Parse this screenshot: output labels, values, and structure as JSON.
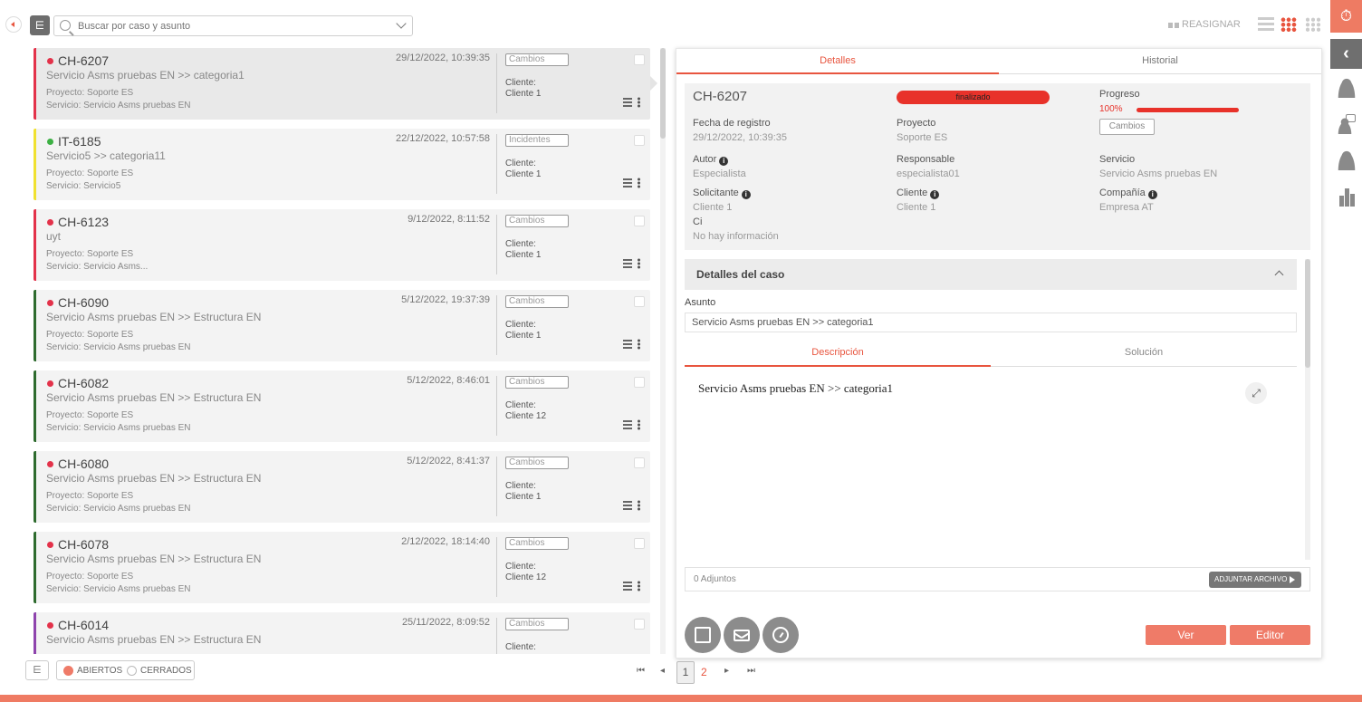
{
  "toolbar": {
    "search_placeholder": "Buscar por caso y asunto",
    "reassign_label": "REASIGNAR",
    "accent_color": "#e8553f"
  },
  "cases": [
    {
      "id": "CH-6207",
      "date": "29/12/2022, 10:39:35",
      "subject": "Servicio Asms pruebas EN >> categoria1",
      "project": "Proyecto: Soporte ES",
      "service": "Servicio: Servicio Asms pruebas EN",
      "category": "Cambios",
      "client_label": "Cliente:",
      "client": "Cliente 1",
      "dot_color": "#e3324a",
      "bar_color": "#e3324a"
    },
    {
      "id": "IT-6185",
      "date": "22/12/2022, 10:57:58",
      "subject": "Servicio5 >> categoria11",
      "project": "Proyecto: Soporte ES",
      "service": "Servicio: Servicio5",
      "category": "Incidentes",
      "client_label": "Cliente:",
      "client": "Cliente 1",
      "dot_color": "#3cb043",
      "bar_color": "#f0e130"
    },
    {
      "id": "CH-6123",
      "date": "9/12/2022, 8:11:52",
      "subject": "uyt",
      "project": "Proyecto: Soporte ES",
      "service": "Servicio: Servicio Asms...",
      "category": "Cambios",
      "client_label": "Cliente:",
      "client": "Cliente 1",
      "dot_color": "#e3324a",
      "bar_color": "#e3324a"
    },
    {
      "id": "CH-6090",
      "date": "5/12/2022, 19:37:39",
      "subject": "Servicio Asms pruebas EN >> Estructura EN",
      "project": "Proyecto: Soporte ES",
      "service": "Servicio: Servicio Asms pruebas EN",
      "category": "Cambios",
      "client_label": "Cliente:",
      "client": "Cliente 1",
      "dot_color": "#e3324a",
      "bar_color": "#2e6b2e"
    },
    {
      "id": "CH-6082",
      "date": "5/12/2022, 8:46:01",
      "subject": "Servicio Asms pruebas EN >> Estructura EN",
      "project": "Proyecto: Soporte ES",
      "service": "Servicio: Servicio Asms pruebas EN",
      "category": "Cambios",
      "client_label": "Cliente:",
      "client": "Cliente 12",
      "dot_color": "#e3324a",
      "bar_color": "#2e6b2e"
    },
    {
      "id": "CH-6080",
      "date": "5/12/2022, 8:41:37",
      "subject": "Servicio Asms pruebas EN >> Estructura EN",
      "project": "Proyecto: Soporte ES",
      "service": "Servicio: Servicio Asms pruebas EN",
      "category": "Cambios",
      "client_label": "Cliente:",
      "client": "Cliente 1",
      "dot_color": "#e3324a",
      "bar_color": "#2e6b2e"
    },
    {
      "id": "CH-6078",
      "date": "2/12/2022, 18:14:40",
      "subject": "Servicio Asms pruebas EN >> Estructura EN",
      "project": "Proyecto: Soporte ES",
      "service": "Servicio: Servicio Asms pruebas EN",
      "category": "Cambios",
      "client_label": "Cliente:",
      "client": "Cliente 12",
      "dot_color": "#e3324a",
      "bar_color": "#2e6b2e"
    },
    {
      "id": "CH-6014",
      "date": "25/11/2022, 8:09:52",
      "subject": "Servicio Asms pruebas EN >> Estructura EN",
      "project": "",
      "service": "",
      "category": "Cambios",
      "client_label": "Cliente:",
      "client": "",
      "dot_color": "#e3324a",
      "bar_color": "#8e44ad"
    }
  ],
  "detail": {
    "tabs": [
      "Detalles",
      "Historial"
    ],
    "id": "CH-6207",
    "status": "finalizado",
    "progress_label": "Progreso",
    "progress_text": "100%",
    "progress_fraction": 1.0,
    "category": "Cambios",
    "fields": {
      "fecha_label": "Fecha de registro",
      "fecha": "29/12/2022, 10:39:35",
      "proyecto_label": "Proyecto",
      "proyecto": "Soporte ES",
      "autor_label": "Autor",
      "autor": "Especialista",
      "responsable_label": "Responsable",
      "responsable": "especialista01",
      "servicio_label": "Servicio",
      "servicio": "Servicio Asms pruebas EN",
      "solicitante_label": "Solicitante",
      "solicitante": "Cliente 1",
      "cliente_label": "Cliente",
      "cliente": "Cliente 1",
      "compania_label": "Compañía",
      "compania": "Empresa AT",
      "ci_label": "Ci",
      "ci": "No hay información"
    },
    "section_title": "Detalles del caso",
    "asunto_label": "Asunto",
    "asunto": "Servicio Asms pruebas EN >> categoria1",
    "desc_tabs": [
      "Descripción",
      "Solución"
    ],
    "description": "Servicio Asms pruebas EN >> categoria1",
    "attachments": "0 Adjuntos",
    "attach_button": "ADJUNTAR ARCHIVO",
    "view_button": "Ver",
    "edit_button": "Editor"
  },
  "bottom": {
    "open_label": "ABIERTOS",
    "closed_label": "CERRADOS",
    "current_page": "1",
    "next_page": "2"
  }
}
